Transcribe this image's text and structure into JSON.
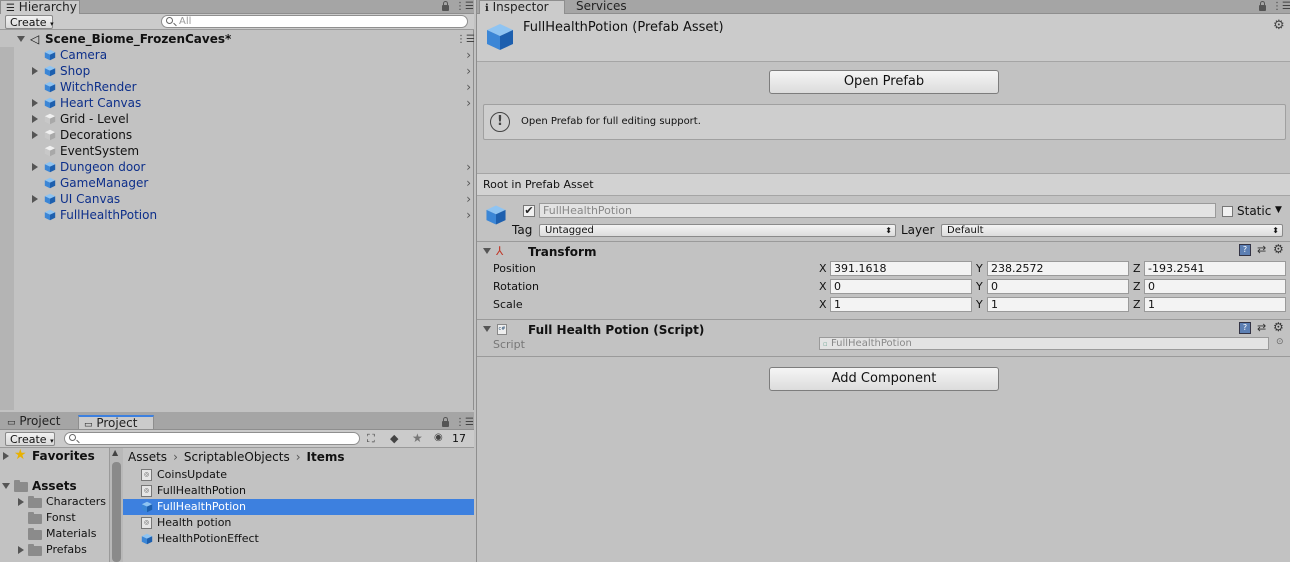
{
  "hierarchy": {
    "tab": "Hierarchy",
    "create_label": "Create",
    "search_placeholder": "All",
    "scene_name": "Scene_Biome_FrozenCaves*",
    "items": [
      {
        "label": "Camera",
        "prefab": true,
        "expandable": false,
        "chevron": true
      },
      {
        "label": "Shop",
        "prefab": true,
        "expandable": true,
        "chevron": true
      },
      {
        "label": "WitchRender",
        "prefab": true,
        "expandable": false,
        "chevron": true
      },
      {
        "label": "Heart Canvas",
        "prefab": true,
        "expandable": true,
        "chevron": true
      },
      {
        "label": "Grid - Level",
        "prefab": false,
        "expandable": true,
        "chevron": false
      },
      {
        "label": "Decorations",
        "prefab": false,
        "expandable": true,
        "chevron": false
      },
      {
        "label": "EventSystem",
        "prefab": false,
        "expandable": false,
        "chevron": false
      },
      {
        "label": "Dungeon door",
        "prefab": true,
        "expandable": true,
        "chevron": true
      },
      {
        "label": "GameManager",
        "prefab": true,
        "expandable": false,
        "chevron": true
      },
      {
        "label": "UI Canvas",
        "prefab": true,
        "expandable": true,
        "chevron": true
      },
      {
        "label": "FullHealthPotion",
        "prefab": true,
        "expandable": false,
        "chevron": true
      }
    ]
  },
  "project": {
    "tabs": [
      "Project",
      "Project"
    ],
    "create_label": "Create",
    "hidden_count": "17",
    "favorites_label": "Favorites",
    "assets_label": "Assets",
    "tree": [
      "Characters",
      "Fonst",
      "Materials",
      "Prefabs"
    ],
    "breadcrumb": [
      "Assets",
      "ScriptableObjects",
      "Items"
    ],
    "files": [
      {
        "label": "CoinsUpdate",
        "type": "script",
        "selected": false
      },
      {
        "label": "FullHealthPotion",
        "type": "script",
        "selected": false
      },
      {
        "label": "FullHealthPotion",
        "type": "prefab",
        "selected": true
      },
      {
        "label": "Health potion",
        "type": "script",
        "selected": false
      },
      {
        "label": "HealthPotionEffect",
        "type": "prefab",
        "selected": false
      }
    ]
  },
  "inspector": {
    "tabs": [
      "Inspector",
      "Services"
    ],
    "title": "FullHealthPotion (Prefab Asset)",
    "open_prefab_label": "Open Prefab",
    "help_text": "Open Prefab for full editing support.",
    "root_label": "Root in Prefab Asset",
    "object_name": "FullHealthPotion",
    "static_label": "Static",
    "tag_label": "Tag",
    "tag_value": "Untagged",
    "layer_label": "Layer",
    "layer_value": "Default",
    "transform": {
      "title": "Transform",
      "rows": [
        {
          "label": "Position",
          "x": "391.1618",
          "y": "238.2572",
          "z": "-193.2541"
        },
        {
          "label": "Rotation",
          "x": "0",
          "y": "0",
          "z": "0"
        },
        {
          "label": "Scale",
          "x": "1",
          "y": "1",
          "z": "1"
        }
      ]
    },
    "script_component": {
      "title": "Full Health Potion (Script)",
      "script_label": "Script",
      "script_value": "FullHealthPotion"
    },
    "add_component_label": "Add Component",
    "axis_x": "X",
    "axis_y": "Y",
    "axis_z": "Z"
  },
  "colors": {
    "selection": "#3d80df",
    "prefab_text": "#0d2f8a",
    "panel_bg": "#c2c2c2"
  }
}
